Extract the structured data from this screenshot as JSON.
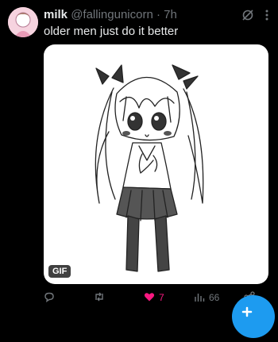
{
  "tweet": {
    "display_name": "milk",
    "handle": "@fallingunicorn",
    "separator": "·",
    "time": "7h",
    "text": "older men just do it better",
    "media_badge": "GIF"
  },
  "actions": {
    "replies": "",
    "retweets": "",
    "likes": "7",
    "views": "66"
  },
  "colors": {
    "background": "#000000",
    "text": "#e7e9ea",
    "muted": "#71767b",
    "like": "#f91880",
    "accent": "#1d9bf0"
  }
}
